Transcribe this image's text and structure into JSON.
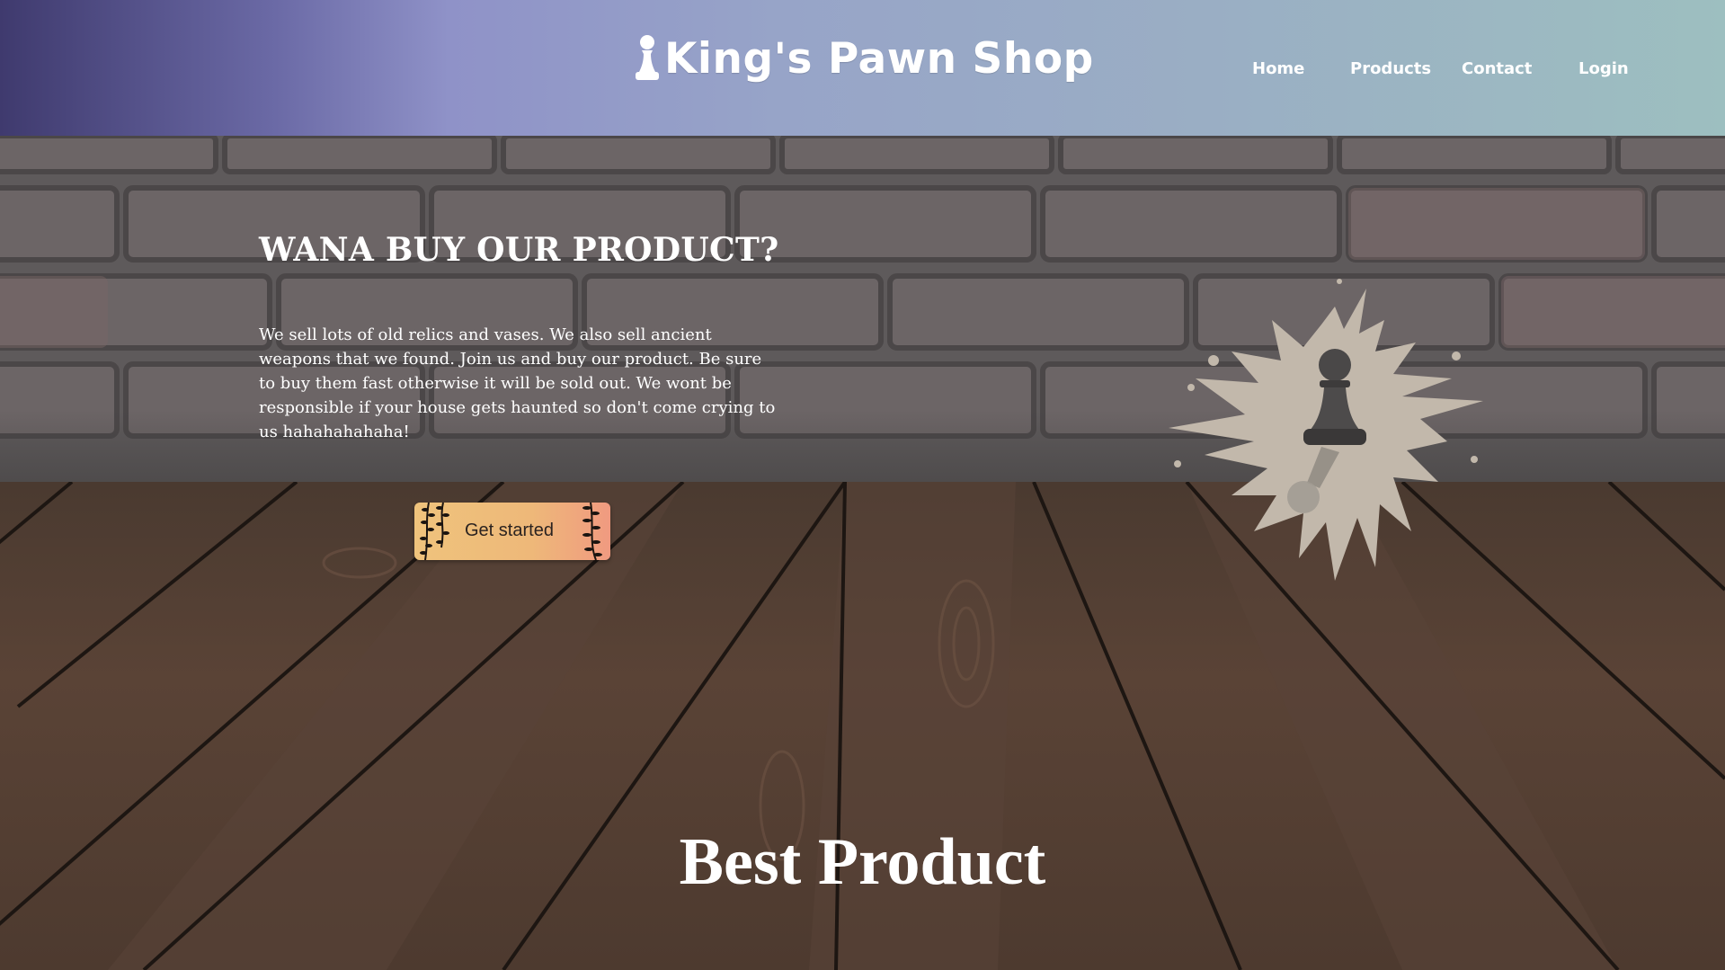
{
  "header": {
    "brand": "King's Pawn Shop",
    "logo_icon": "pawn-icon",
    "nav": [
      {
        "label": "Home"
      },
      {
        "label": "Products"
      },
      {
        "label": "Contact"
      },
      {
        "label": "Login"
      }
    ],
    "gradient_colors": [
      "#3f3a6e",
      "#8f92c8",
      "#9dbfc0"
    ]
  },
  "hero": {
    "title": "WANA BUY OUR PRODUCT?",
    "description": "We sell lots of old relics and vases. We also sell ancient weapons that we found. Join us and buy our product. Be sure to buy them fast otherwise it will be sold out. We wont be responsible if your house gets haunted so don't come crying to us hahahahahaha!",
    "cta_label": "Get started",
    "cta_colors": [
      "#efc37c",
      "#f09a80"
    ],
    "illustration": "chess-pawn-splash-icon"
  },
  "section": {
    "title": "Best Product"
  }
}
